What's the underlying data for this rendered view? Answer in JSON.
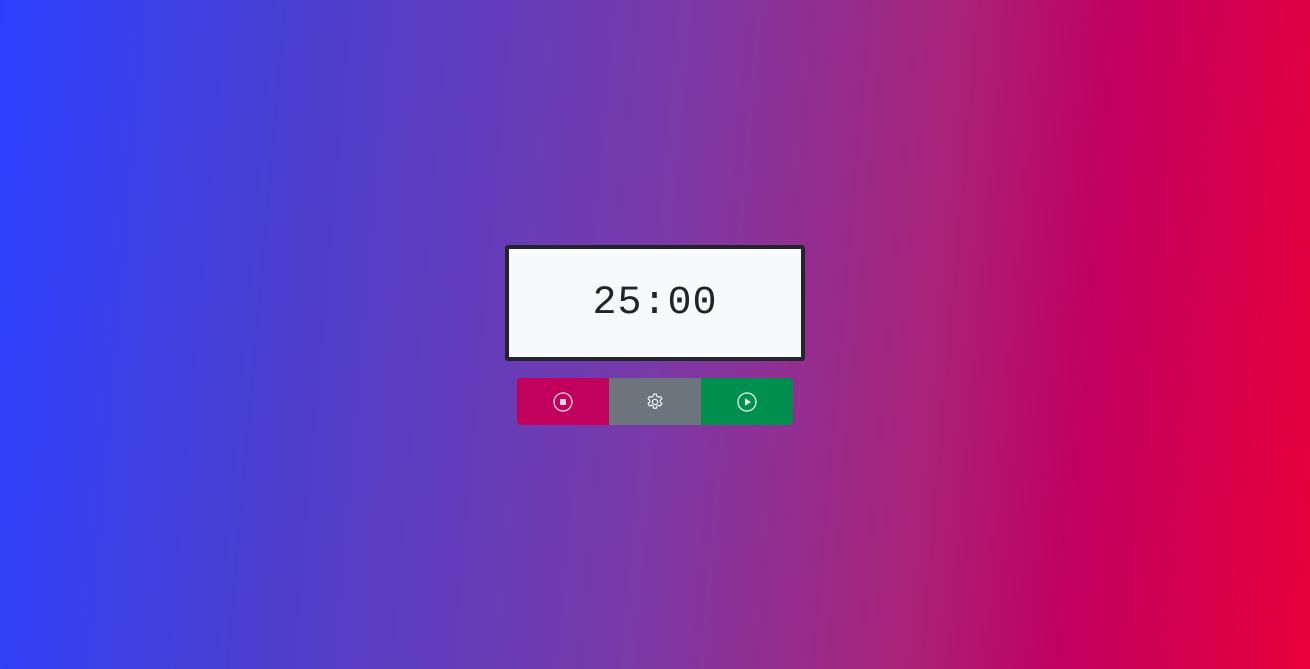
{
  "timer": {
    "display": "25:00"
  },
  "controls": {
    "stop": {
      "icon": "stop-circle-icon",
      "color": "#c2005d"
    },
    "settings": {
      "icon": "gear-icon",
      "color": "#6c757d"
    },
    "play": {
      "icon": "play-circle-icon",
      "color": "#008f4f"
    }
  },
  "background": {
    "gradient_start": "#2c41ff",
    "gradient_end": "#e8003a"
  }
}
